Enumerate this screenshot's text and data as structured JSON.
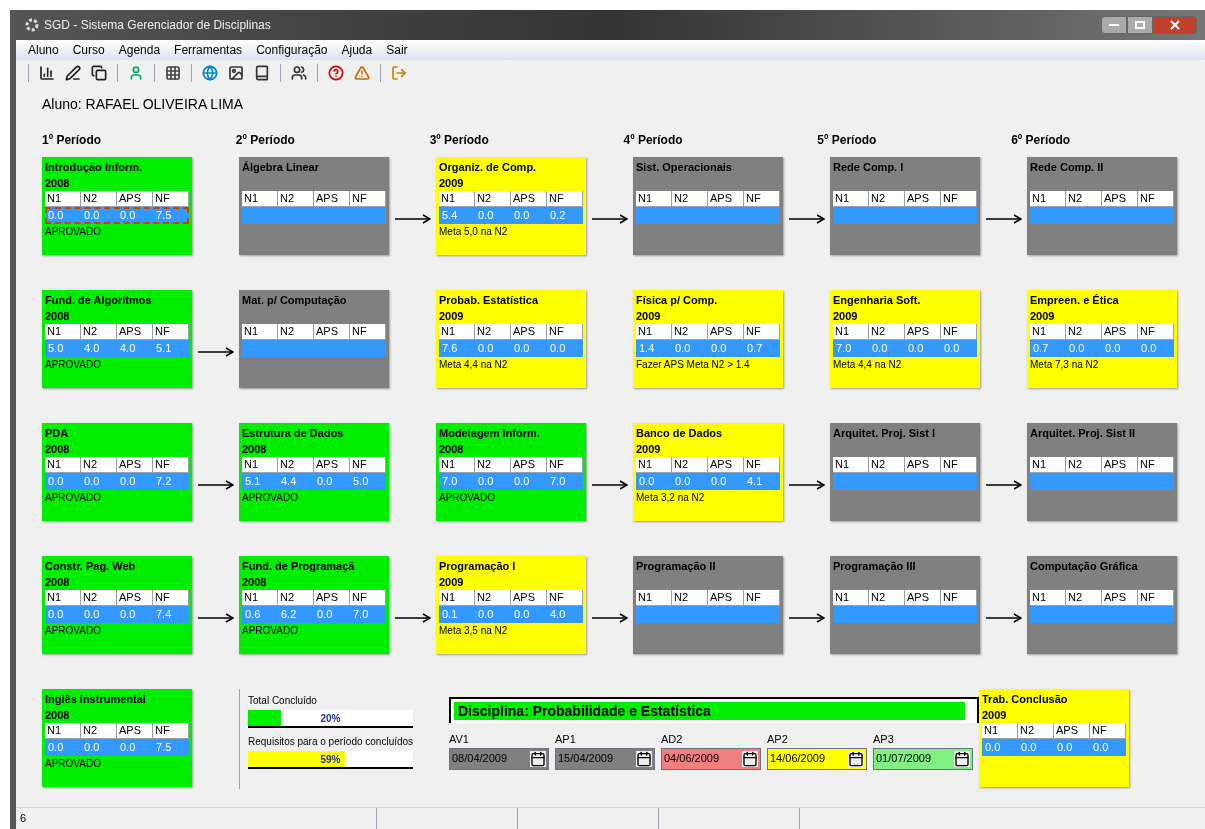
{
  "window": {
    "title": "SGD - Sistema Gerenciador de Disciplinas"
  },
  "menu": [
    "Aluno",
    "Curso",
    "Agenda",
    "Ferramentas",
    "Configuração",
    "Ajuda",
    "Sair"
  ],
  "toolbar": [
    {
      "kind": "chart"
    },
    {
      "kind": "edit"
    },
    {
      "kind": "copy"
    },
    {
      "kind": "separator"
    },
    {
      "kind": "person"
    },
    {
      "kind": "separator"
    },
    {
      "kind": "grid"
    },
    {
      "kind": "separator"
    },
    {
      "kind": "globe"
    },
    {
      "kind": "image"
    },
    {
      "kind": "book"
    },
    {
      "kind": "separator"
    },
    {
      "kind": "people"
    },
    {
      "kind": "separator"
    },
    {
      "kind": "help"
    },
    {
      "kind": "alert"
    },
    {
      "kind": "separator"
    },
    {
      "kind": "exit"
    }
  ],
  "student": "Aluno: RAFAEL OLIVEIRA LIMA",
  "periods": [
    "1º Período",
    "2º Período",
    "3º Período",
    "4º Período",
    "5º Período",
    "6º Período"
  ],
  "rows": [
    [
      {
        "title": "Introdução Inform.",
        "year": "2008",
        "color": "#00ee00",
        "arrow": false,
        "selected": true,
        "headers": [
          "N1",
          "N2",
          "APS",
          "NF"
        ],
        "grades": [
          "0.0",
          "0.0",
          "0.0",
          "7.5"
        ],
        "status": "APROVADO"
      },
      {
        "title": "Álgebra Linear",
        "color": "#808080",
        "arrow": false,
        "selected": false,
        "headers": [
          "N1",
          "N2",
          "APS",
          "NF"
        ]
      },
      {
        "title": "Organiz. de Comp.",
        "year": "2009",
        "color": "#ffff00",
        "arrow": true,
        "selected": false,
        "headers": [
          "N1",
          "N2",
          "APS",
          "NF"
        ],
        "grades": [
          "5.4",
          "0.0",
          "0.0",
          "0.2"
        ],
        "status": "Meta 5,0 na N2"
      },
      {
        "title": "Sist. Operacionais",
        "color": "#808080",
        "arrow": true,
        "selected": false,
        "headers": [
          "N1",
          "N2",
          "APS",
          "NF"
        ]
      },
      {
        "title": "Rede Comp. I",
        "color": "#808080",
        "arrow": true,
        "selected": false,
        "headers": [
          "N1",
          "N2",
          "APS",
          "NF"
        ]
      },
      {
        "title": "Rede Comp. II",
        "color": "#808080",
        "arrow": true,
        "selected": false,
        "headers": [
          "N1",
          "N2",
          "APS",
          "NF"
        ]
      }
    ],
    [
      {
        "title": "Fund. de Algoritmos",
        "year": "2008",
        "color": "#00ee00",
        "arrow": false,
        "selected": false,
        "headers": [
          "N1",
          "N2",
          "APS",
          "NF"
        ],
        "grades": [
          "5.0",
          "4.0",
          "4.0",
          "5.1"
        ],
        "status": "APROVADO"
      },
      {
        "title": "Mat. p/ Computação",
        "color": "#808080",
        "arrow": true,
        "selected": false,
        "headers": [
          "N1",
          "N2",
          "APS",
          "NF"
        ]
      },
      {
        "title": "Probab. Estatística",
        "year": "2009",
        "color": "#ffff00",
        "arrow": false,
        "selected": false,
        "headers": [
          "N1",
          "N2",
          "APS",
          "NF"
        ],
        "grades": [
          "7.6",
          "0.0",
          "0.0",
          "0.0"
        ],
        "status": "Meta 4,4 na N2"
      },
      {
        "title": "Física p/ Comp.",
        "year": "2009",
        "color": "#ffff00",
        "arrow": false,
        "selected": false,
        "headers": [
          "N1",
          "N2",
          "APS",
          "NF"
        ],
        "grades": [
          "1.4",
          "0.0",
          "0.0",
          "0.7"
        ],
        "status": "Fazer APS Meta N2 > 1.4"
      },
      {
        "title": "Engenharia Soft.",
        "year": "2009",
        "color": "#ffff00",
        "arrow": false,
        "selected": false,
        "headers": [
          "N1",
          "N2",
          "APS",
          "NF"
        ],
        "grades": [
          "7.0",
          "0.0",
          "0.0",
          "0.0"
        ],
        "status": "Meta 4,4 na N2"
      },
      {
        "title": "Empreen. e Ética",
        "year": "2009",
        "color": "#ffff00",
        "arrow": false,
        "selected": false,
        "headers": [
          "N1",
          "N2",
          "APS",
          "NF"
        ],
        "grades": [
          "0.7",
          "0.0",
          "0.0",
          "0.0"
        ],
        "status": "Meta 7,3 na N2"
      }
    ],
    [
      {
        "title": "PDA",
        "year": "2008",
        "color": "#00ee00",
        "arrow": false,
        "selected": false,
        "headers": [
          "N1",
          "N2",
          "APS",
          "NF"
        ],
        "grades": [
          "0.0",
          "0.0",
          "0.0",
          "7.2"
        ],
        "status": "APROVADO"
      },
      {
        "title": "Estrutura de Dados",
        "year": "2008",
        "color": "#00ee00",
        "arrow": true,
        "selected": false,
        "headers": [
          "N1",
          "N2",
          "APS",
          "NF"
        ],
        "grades": [
          "5.1",
          "4.4",
          "0.0",
          "5.0"
        ],
        "status": "APROVADO"
      },
      {
        "title": "Modelagem Inform.",
        "year": "2008",
        "color": "#00ee00",
        "arrow": false,
        "selected": false,
        "headers": [
          "N1",
          "N2",
          "APS",
          "NF"
        ],
        "grades": [
          "7.0",
          "0.0",
          "0.0",
          "7.0"
        ],
        "status": "APROVADO"
      },
      {
        "title": "Banco de Dados",
        "year": "2009",
        "color": "#ffff00",
        "arrow": true,
        "selected": false,
        "headers": [
          "N1",
          "N2",
          "APS",
          "NF"
        ],
        "grades": [
          "0.0",
          "0.0",
          "0.0",
          "4.1"
        ],
        "status": "Meta 3,2 na N2"
      },
      {
        "title": "Arquitet. Proj. Sist I",
        "color": "#808080",
        "arrow": true,
        "selected": false,
        "headers": [
          "N1",
          "N2",
          "APS",
          "NF"
        ]
      },
      {
        "title": "Arquitet. Proj. Sist II",
        "color": "#808080",
        "arrow": true,
        "selected": false,
        "headers": [
          "N1",
          "N2",
          "APS",
          "NF"
        ]
      }
    ],
    [
      {
        "title": "Constr. Pag. Web",
        "year": "2008",
        "color": "#00ee00",
        "arrow": false,
        "selected": false,
        "headers": [
          "N1",
          "N2",
          "APS",
          "NF"
        ],
        "grades": [
          "0.0",
          "0.0",
          "0.0",
          "7.4"
        ],
        "status": "APROVADO"
      },
      {
        "title": "Fund. de Programaçã",
        "year": "2008",
        "color": "#00ee00",
        "arrow": true,
        "selected": false,
        "headers": [
          "N1",
          "N2",
          "APS",
          "NF"
        ],
        "grades": [
          "0.6",
          "6.2",
          "0.0",
          "7.0"
        ],
        "status": "APROVADO"
      },
      {
        "title": "Programação I",
        "year": "2009",
        "color": "#ffff00",
        "arrow": true,
        "selected": false,
        "headers": [
          "N1",
          "N2",
          "APS",
          "NF"
        ],
        "grades": [
          "0.1",
          "0.0",
          "0.0",
          "4.0"
        ],
        "status": "Meta 3,5 na N2"
      },
      {
        "title": "Programação II",
        "color": "#808080",
        "arrow": true,
        "selected": false,
        "headers": [
          "N1",
          "N2",
          "APS",
          "NF"
        ]
      },
      {
        "title": "Programação III",
        "color": "#808080",
        "arrow": true,
        "selected": false,
        "headers": [
          "N1",
          "N2",
          "APS",
          "NF"
        ]
      },
      {
        "title": "Computação Gráfica",
        "color": "#808080",
        "arrow": true,
        "selected": false,
        "headers": [
          "N1",
          "N2",
          "APS",
          "NF"
        ]
      }
    ]
  ],
  "last_row": {
    "first": {
      "title": "Inglês Instrumental",
      "year": "2008",
      "color": "#00ee00",
      "arrow": false,
      "selected": false,
      "headers": [
        "N1",
        "N2",
        "APS",
        "NF"
      ],
      "grades": [
        "0.0",
        "0.0",
        "0.0",
        "7.5"
      ],
      "status": "APROVADO"
    },
    "last": {
      "title": "Trab. Conclusão",
      "year": "2009",
      "color": "#ffff00",
      "arrow": false,
      "selected": false,
      "headers": [
        "N1",
        "N2",
        "APS",
        "NF"
      ],
      "grades": [
        "0.0",
        "0.0",
        "0.0",
        "0.0"
      ]
    }
  },
  "progress": [
    {
      "label": "Total Concluído",
      "level": 0.2,
      "reading": "20%",
      "color": "#00ee00"
    },
    {
      "label": "Requisitos para o período concluídos",
      "level": 0.59,
      "reading": "59%",
      "color": "#ffff00"
    }
  ],
  "discipline": {
    "title": "Disciplina: Probabilidade e Estatística",
    "dates": [
      {
        "label": "AV1",
        "value": "08/04/2009",
        "color": "#808080"
      },
      {
        "label": "AP1",
        "value": "15/04/2009",
        "color": "#808080"
      },
      {
        "label": "AD2",
        "value": "04/06/2009",
        "color": "#f08080"
      },
      {
        "label": "AP2",
        "value": "14/06/2009",
        "color": "#ffff00"
      },
      {
        "label": "AP3",
        "value": "01/07/2009",
        "color": "#80f080"
      }
    ]
  },
  "status_bar": "6"
}
